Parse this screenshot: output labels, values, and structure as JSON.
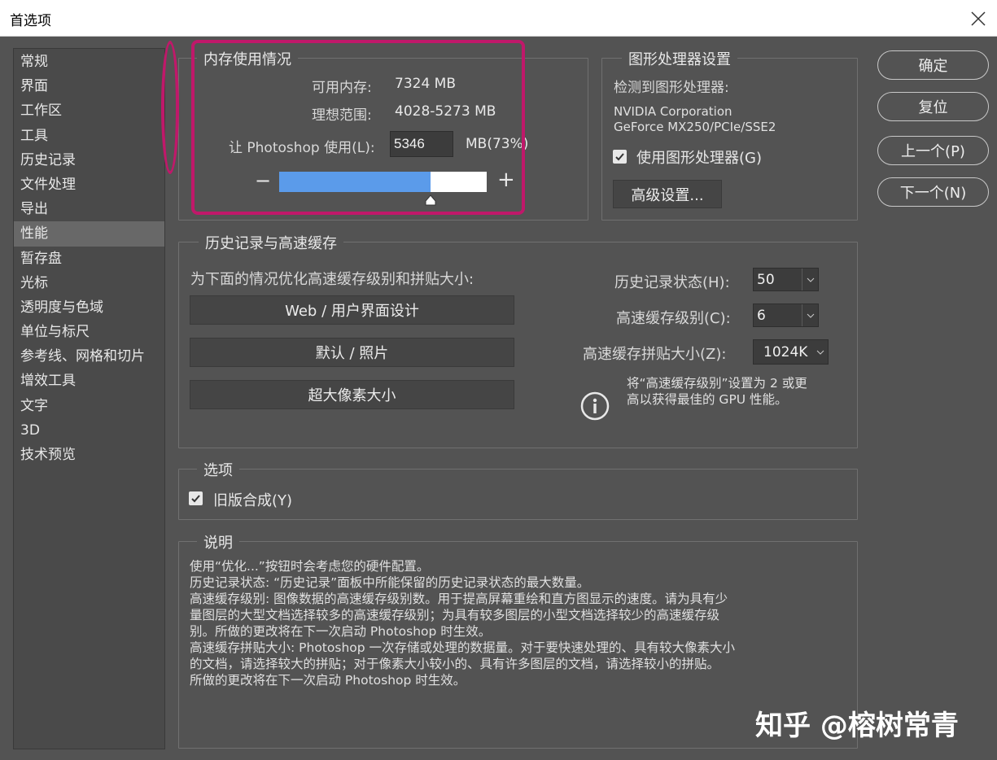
{
  "window": {
    "title": "首选项",
    "close_icon": "close-icon"
  },
  "sidebar": {
    "items": [
      {
        "label": "常规"
      },
      {
        "label": "界面"
      },
      {
        "label": "工作区"
      },
      {
        "label": "工具"
      },
      {
        "label": "历史记录"
      },
      {
        "label": "文件处理"
      },
      {
        "label": "导出"
      },
      {
        "label": "性能"
      },
      {
        "label": "暂存盘"
      },
      {
        "label": "光标"
      },
      {
        "label": "透明度与色域"
      },
      {
        "label": "单位与标尺"
      },
      {
        "label": "参考线、网格和切片"
      },
      {
        "label": "增效工具"
      },
      {
        "label": "文字"
      },
      {
        "label": "3D"
      },
      {
        "label": "技术预览"
      }
    ],
    "selected": "性能"
  },
  "memory": {
    "legend": "内存使用情况",
    "available_label": "可用内存:",
    "available_value": "7324 MB",
    "ideal_label": "理想范围:",
    "ideal_value": "4028-5273 MB",
    "let_use_label": "让 Photoshop 使用(L):",
    "let_use_value": "5346",
    "unit": "MB(73%)",
    "usage_percent": 73,
    "minus": "−",
    "plus": "+"
  },
  "gpu": {
    "legend": "图形处理器设置",
    "detected_label": "检测到图形处理器:",
    "vendor": "NVIDIA Corporation",
    "model": "GeForce MX250/PCIe/SSE2",
    "use_gpu_label": "使用图形处理器(G)",
    "use_gpu_checked": true,
    "advanced_button": "高级设置..."
  },
  "buttons": {
    "ok": "确定",
    "reset": "复位",
    "prev": "上一个(P)",
    "next": "下一个(N)"
  },
  "history_cache": {
    "legend": "历史记录与高速缓存",
    "optimize_label": "为下面的情况优化高速缓存级别和拼贴大小:",
    "btn_web": "Web / 用户界面设计",
    "btn_default": "默认 / 照片",
    "btn_huge": "超大像素大小",
    "history_states_label": "历史记录状态(H):",
    "history_states_value": "50",
    "cache_levels_label": "高速缓存级别(C):",
    "cache_levels_value": "6",
    "tile_size_label": "高速缓存拼贴大小(Z):",
    "tile_size_value": "1024K",
    "info_line1": "将“高速缓存级别”设置为 2 或更",
    "info_line2": "高以获得最佳的 GPU 性能。",
    "info_icon": "info-icon"
  },
  "options": {
    "legend": "选项",
    "legacy_label": "旧版合成(Y)",
    "legacy_checked": true
  },
  "description": {
    "legend": "说明",
    "lines": [
      "使用“优化...”按钮时会考虑您的硬件配置。",
      "历史记录状态: “历史记录”面板中所能保留的历史记录状态的最大数量。",
      "高速缓存级别: 图像数据的高速缓存级别数。用于提高屏幕重绘和直方图显示的速度。请为具有少",
      "量图层的大型文档选择较多的高速缓存级别；为具有较多图层的小型文档选择较少的高速缓存级",
      "别。所做的更改将在下一次启动 Photoshop 时生效。",
      "高速缓存拼贴大小: Photoshop 一次存储或处理的数据量。对于要快速处理的、具有较大像素大小",
      "的文档，请选择较大的拼贴；对于像素大小较小的、具有许多图层的文档，请选择较小的拼贴。",
      "所做的更改将在下一次启动 Photoshop 时生效。"
    ]
  },
  "watermark": "知乎 @榕树常青",
  "colors": {
    "annotation": "#c0186a",
    "slider_fill": "#5b9bea",
    "panel_bg": "#535353"
  }
}
